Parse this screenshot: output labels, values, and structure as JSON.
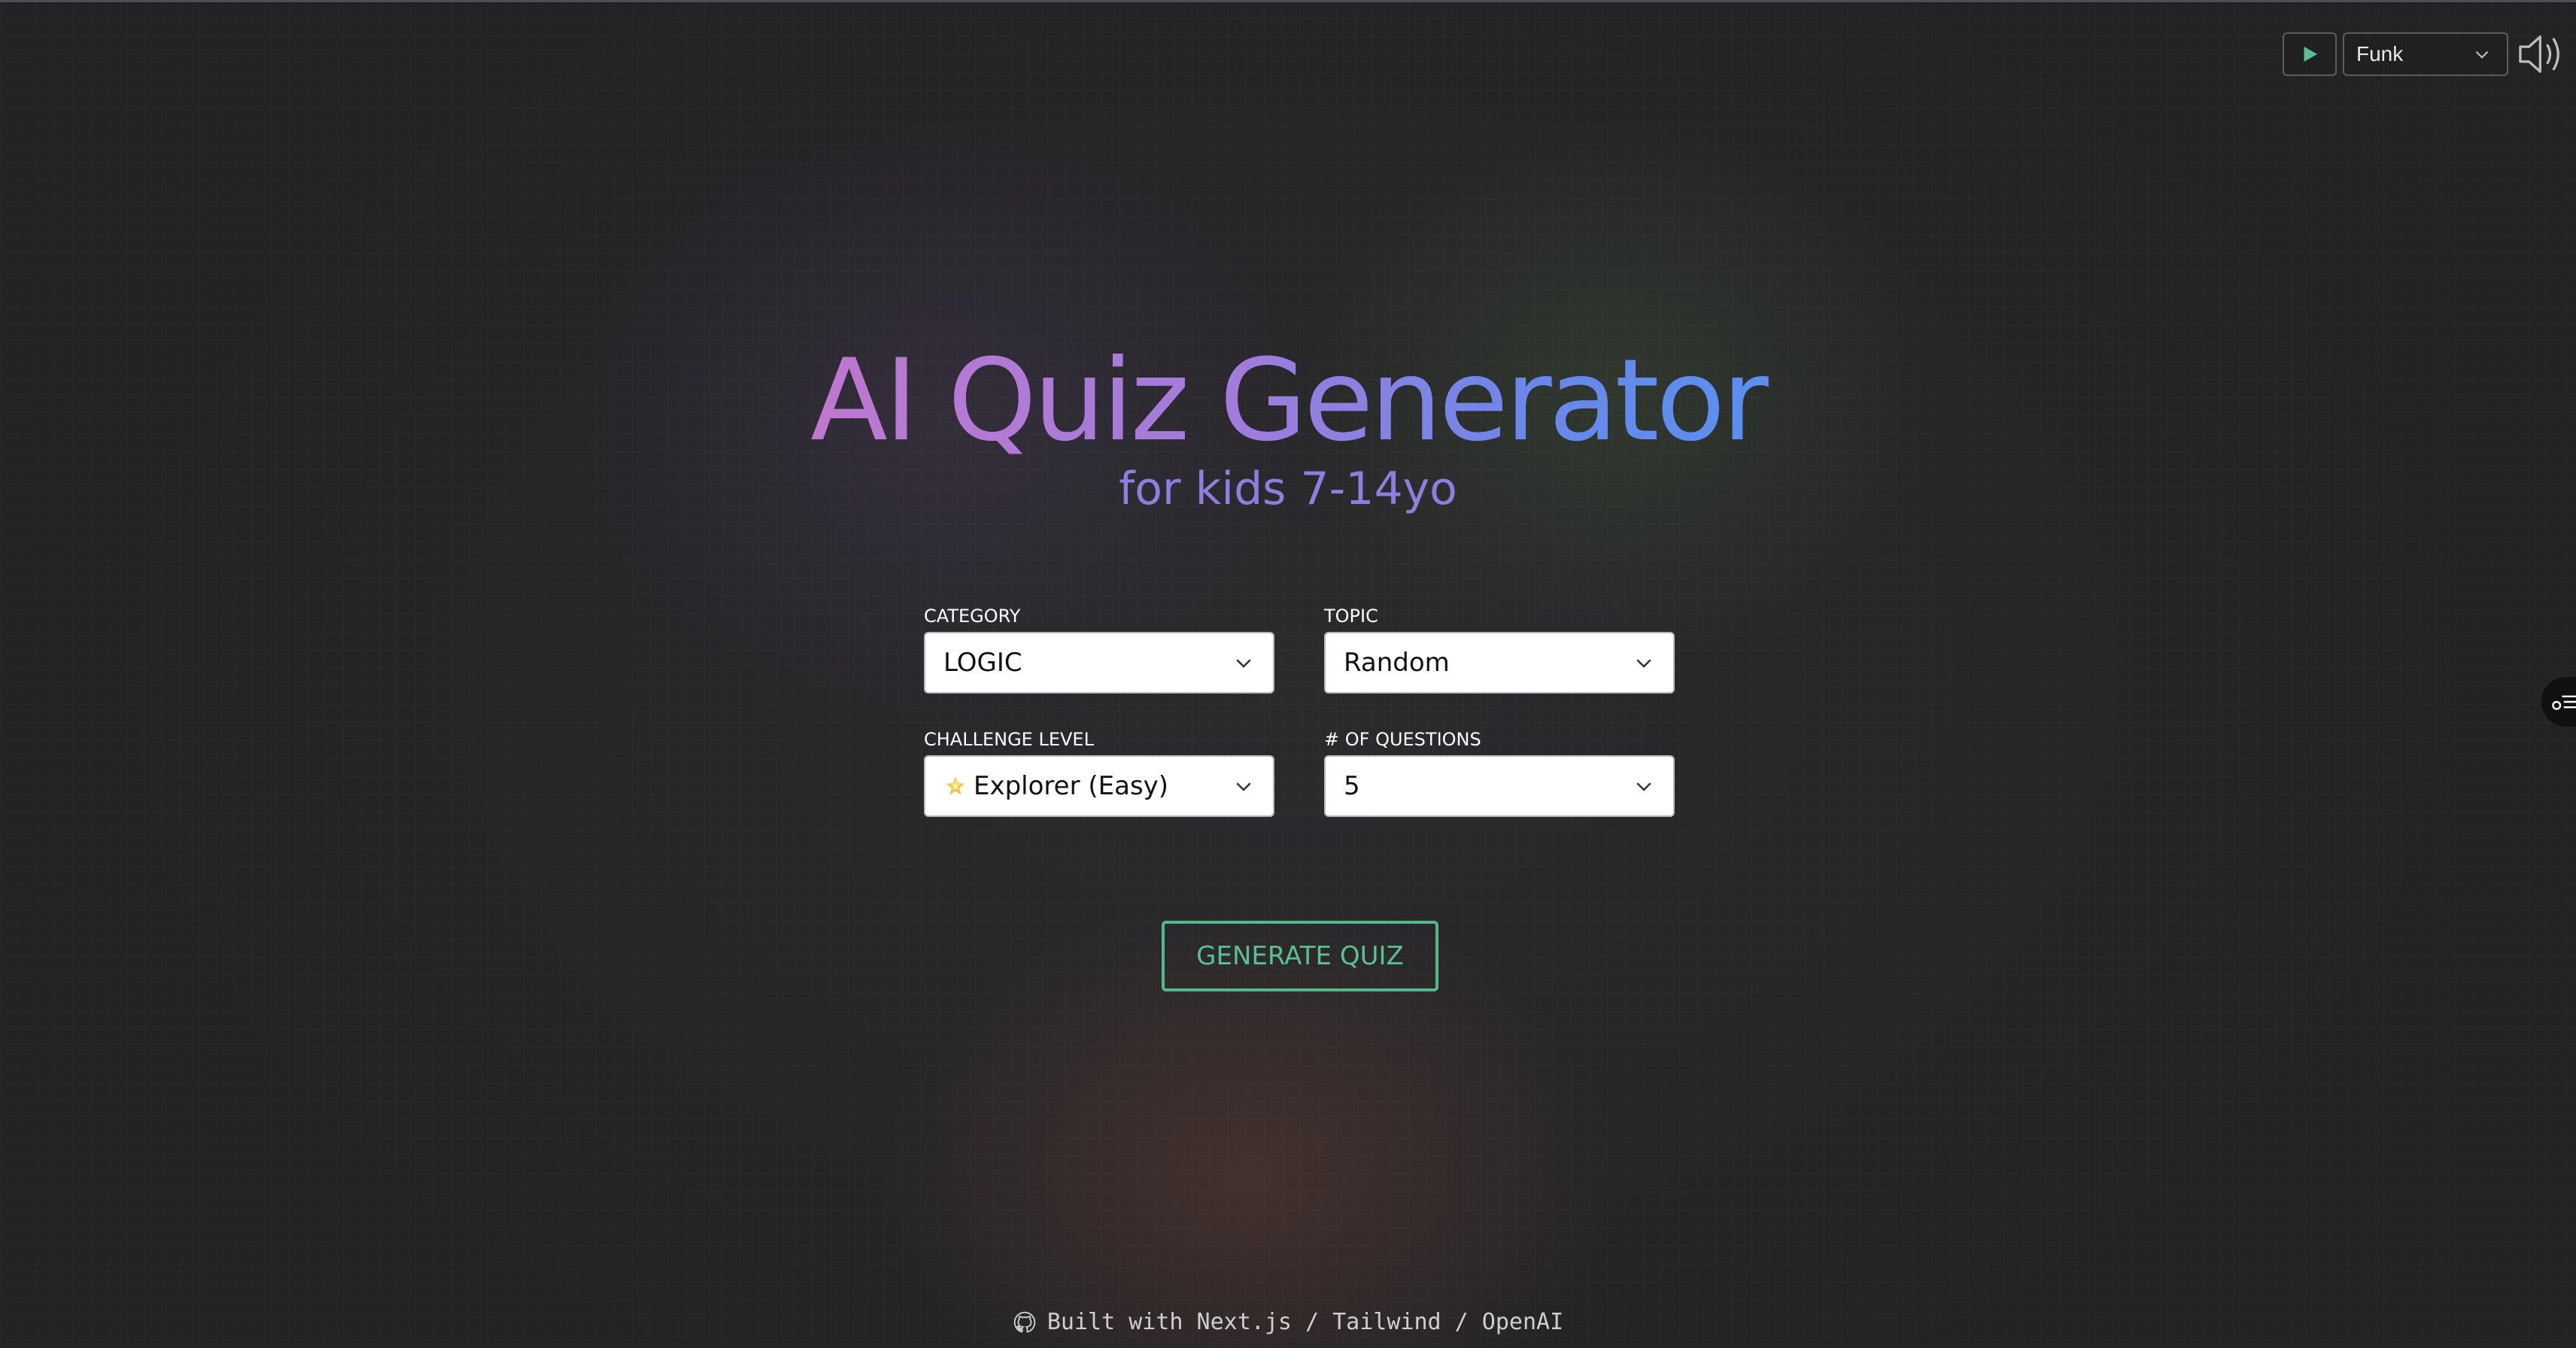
{
  "header": {
    "music_track": "Funk",
    "icons": [
      "play-icon",
      "chevron-down-icon",
      "volume-icon"
    ]
  },
  "side_tab": {
    "icon": "settings-list-icon"
  },
  "hero": {
    "title": "AI Quiz Generator",
    "subtitle": "for kids 7-14yo"
  },
  "form": {
    "category": {
      "label": "CATEGORY",
      "value": "LOGIC"
    },
    "topic": {
      "label": "TOPIC",
      "value": "Random"
    },
    "challenge": {
      "label": "CHALLENGE LEVEL",
      "value": "Explorer (Easy)",
      "icon": "star-icon"
    },
    "questions": {
      "label": "# OF QUESTIONS",
      "value": "5"
    }
  },
  "actions": {
    "generate_label": "GENERATE QUIZ"
  },
  "footer": {
    "text": "Built with Next.js / Tailwind / OpenAI",
    "icon": "github-icon"
  },
  "colors": {
    "background": "#2b2a2d",
    "accent_green": "#58c091",
    "title_gradient_start": "#bf78cf",
    "title_gradient_end": "#5a8ff0",
    "subtitle": "#8b80e0"
  }
}
